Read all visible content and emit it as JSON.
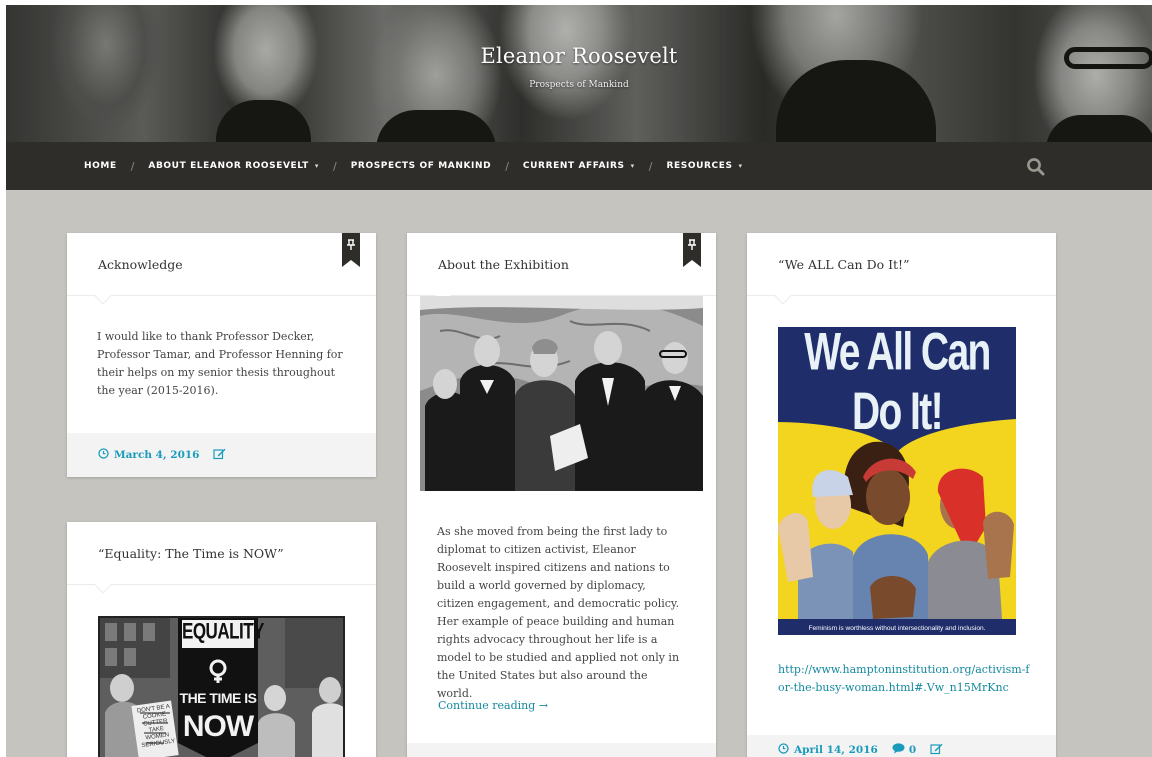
{
  "site": {
    "title": "Eleanor Roosevelt",
    "tagline": "Prospects of Mankind"
  },
  "nav": {
    "items": [
      {
        "label": "HOME",
        "has_dropdown": false
      },
      {
        "label": "ABOUT ELEANOR ROOSEVELT",
        "has_dropdown": true
      },
      {
        "label": "PROSPECTS OF MANKIND",
        "has_dropdown": false
      },
      {
        "label": "CURRENT AFFAIRS",
        "has_dropdown": true
      },
      {
        "label": "RESOURCES",
        "has_dropdown": true
      }
    ],
    "separator": "/",
    "dropdown_glyph": "▾",
    "search_icon": "search-icon"
  },
  "posts": {
    "acknowledge": {
      "title": "Acknowledge",
      "pinned": true,
      "excerpt": "I would like to thank Professor Decker, Professor Tamar, and Professor Henning for their helps on my senior thesis throughout the year (2015-2016).",
      "date": "March 4, 2016",
      "icons": [
        "clock-icon",
        "edit-icon"
      ]
    },
    "exhibition": {
      "title": "About the Exhibition",
      "pinned": true,
      "image": "photo of Eleanor Roosevelt with men in suits before a world map",
      "excerpt": "As she moved from being the first lady to diplomat to citizen activist, Eleanor Roosevelt inspired citizens and nations to build a world governed by diplomacy, citizen engagement, and democratic policy. Her example of peace building and human rights advocacy throughout her life is a model to be studied and applied not only in the United States but also around the world.",
      "continue_label": "Continue reading →"
    },
    "we_all": {
      "title": "“We ALL Can Do It!”",
      "poster_heading": "We All Can Do It!",
      "poster_caption": "Feminism is worthless without intersectionality and inclusion.",
      "link": "http://www.hamptoninstitution.org/activism-for-the-busy-woman.html#.Vw_n15MrKnc",
      "date": "April 14, 2016",
      "comments": "0",
      "icons": [
        "clock-icon",
        "comment-icon",
        "edit-icon"
      ]
    },
    "equality": {
      "title": "“Equality: The Time is NOW”",
      "banner_top": "EQUALITY",
      "banner_mid": "THE TIME IS",
      "banner_bottom": "NOW",
      "placard": "DON'T BE A COOKIE CUTTER TAKE WOMEN SERIOUSLY"
    }
  },
  "colors": {
    "nav_bg": "#2f2d29",
    "content_bg": "#c6c4bf",
    "link": "#14899f",
    "meta": "#1a9bbc",
    "poster_yellow": "#f3d41e",
    "poster_blue": "#1f2e6b"
  }
}
